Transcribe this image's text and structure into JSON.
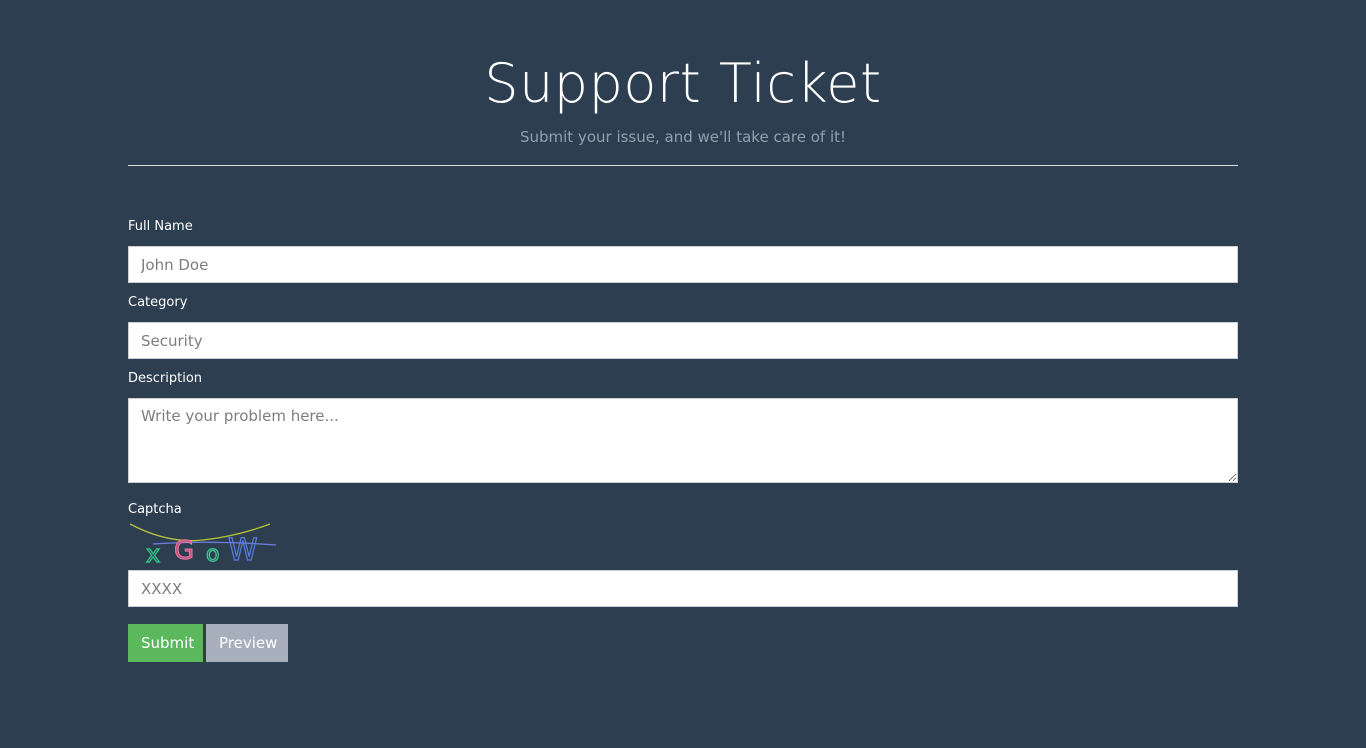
{
  "header": {
    "title": "Support Ticket",
    "subtitle": "Submit your issue, and we'll take care of it!"
  },
  "form": {
    "full_name": {
      "label": "Full Name",
      "value": "",
      "placeholder": "John Doe"
    },
    "category": {
      "label": "Category",
      "value": "",
      "placeholder": "Security"
    },
    "description": {
      "label": "Description",
      "value": "",
      "placeholder": "Write your problem here..."
    },
    "captcha": {
      "label": "Captcha",
      "image_text": "xGoW",
      "value": "",
      "placeholder": "XXXX"
    },
    "buttons": {
      "submit_label": "Submit",
      "preview_label": "Preview"
    }
  },
  "colors": {
    "background": "#2c3e50",
    "submit": "#5cb85c",
    "preview": "#a6afbb"
  }
}
